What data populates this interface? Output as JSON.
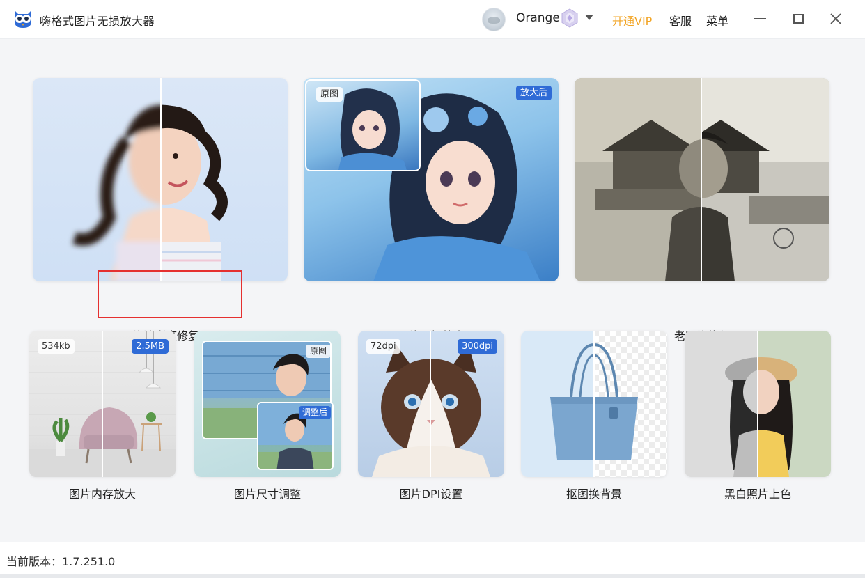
{
  "titlebar": {
    "app_title": "嗨格式图片无损放大器",
    "username": "Orange",
    "vip_label": "开通VIP",
    "service_label": "客服",
    "menu_label": "菜单",
    "icons": [
      "owl-logo-icon",
      "avatar",
      "vip-diamond-icon",
      "chevron-down-icon",
      "minimize-icon",
      "maximize-icon",
      "close-icon"
    ]
  },
  "features_top": [
    {
      "label": "图片清晰度修复"
    },
    {
      "label": "图片无损放大",
      "tag_left": "原图",
      "tag_right": "放大后"
    },
    {
      "label": "老照片修复"
    }
  ],
  "features_bottom": [
    {
      "label": "图片内存放大",
      "tag_left": "534kb",
      "tag_right": "2.5MB"
    },
    {
      "label": "图片尺寸调整",
      "tag_top": "原图",
      "tag_bottom": "调整后"
    },
    {
      "label": "图片DPI设置",
      "tag_left": "72dpi",
      "tag_right": "300dpi"
    },
    {
      "label": "抠图换背景"
    },
    {
      "label": "黑白照片上色"
    }
  ],
  "footer": {
    "version": "当前版本：1.7.251.0"
  },
  "colors": {
    "accent_blue": "#2f6bd6",
    "vip_orange": "#f2a424",
    "highlight_red": "#e53030"
  }
}
